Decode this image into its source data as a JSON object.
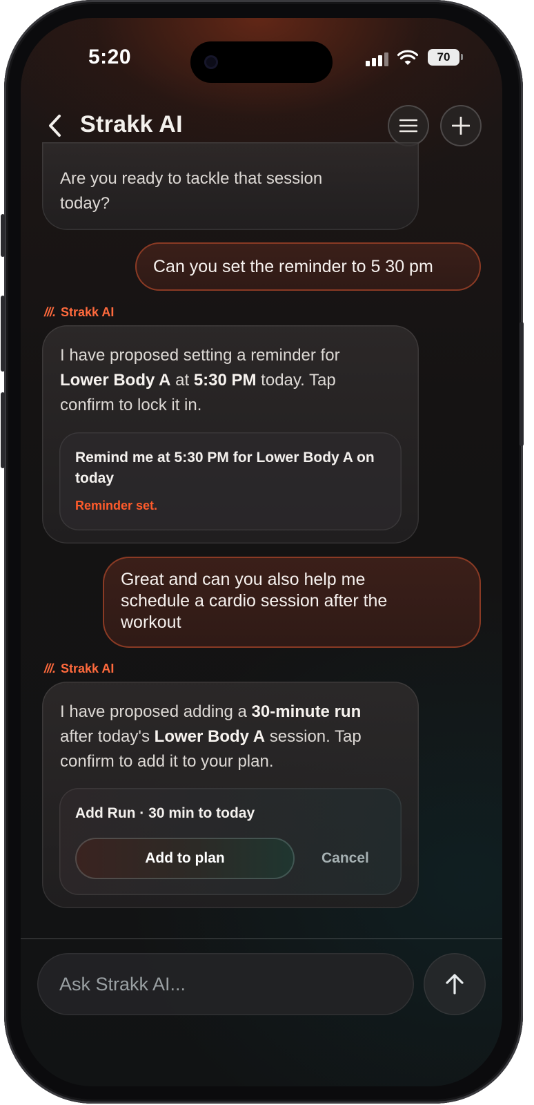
{
  "status_bar": {
    "time": "5:20",
    "battery": "70"
  },
  "header": {
    "title": "Strakk AI"
  },
  "messages": {
    "m1": {
      "text": "Are you ready to tackle that session today?"
    },
    "m2": {
      "text": "Can you set the reminder to 5 30 pm"
    },
    "m3": {
      "sender": "Strakk AI",
      "sender_mark": "///.",
      "p1": "I have proposed setting a reminder for ",
      "b1": "Lower Body A",
      "p2": " at ",
      "b2": "5:30 PM",
      "p3": " today. Tap confirm to lock it in.",
      "card_title": "Remind me at 5:30 PM for Lower Body A on today",
      "card_status": "Reminder set."
    },
    "m4": {
      "text": "Great and can you also help me schedule a cardio session after the workout"
    },
    "m5": {
      "sender": "Strakk AI",
      "sender_mark": "///.",
      "p1": "I have proposed adding a ",
      "b1": "30-minute run",
      "p2": " after today's ",
      "b2": "Lower Body A",
      "p3": " session. Tap confirm to add it to your plan.",
      "card_title": "Add Run · 30 min to today",
      "primary_action": "Add to plan",
      "secondary_action": "Cancel"
    }
  },
  "composer": {
    "placeholder": "Ask Strakk AI..."
  },
  "colors": {
    "accent": "#ff6a3d",
    "user_bubble_border": "#8a3a24",
    "background": "#151313"
  }
}
